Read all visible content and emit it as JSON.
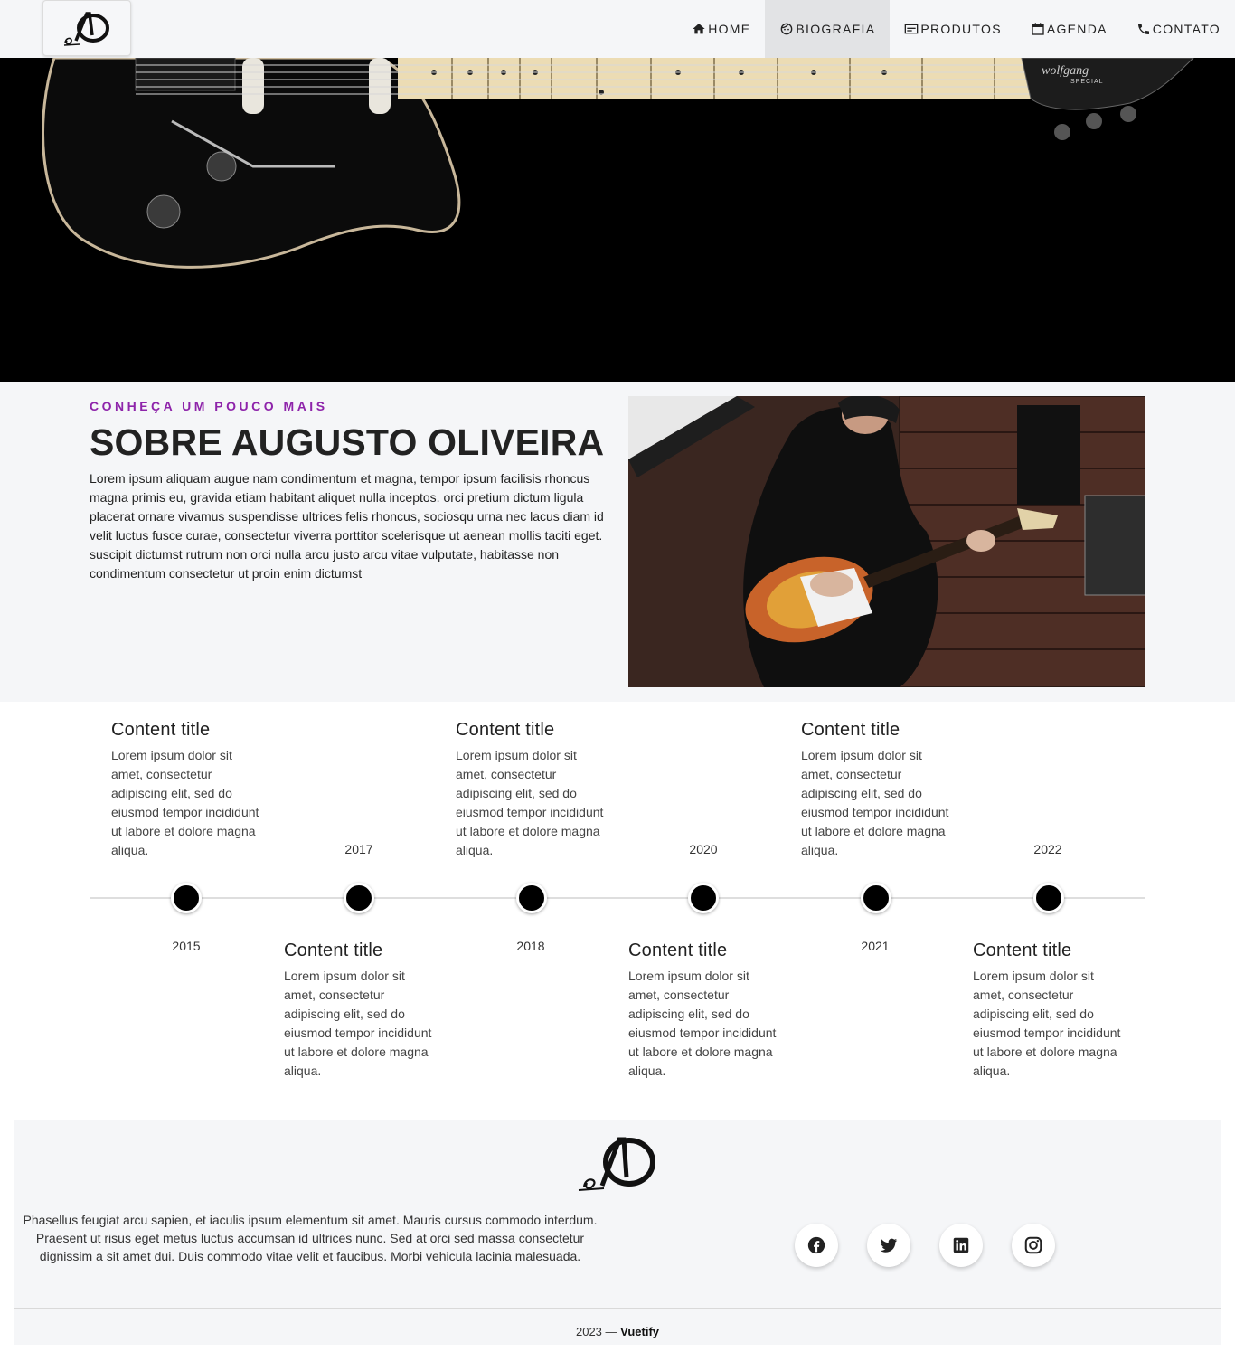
{
  "nav": {
    "items": [
      {
        "label": "HOME",
        "icon": "home-icon"
      },
      {
        "label": "BIOGRAFIA",
        "icon": "face-icon"
      },
      {
        "label": "PRODUTOS",
        "icon": "card-icon"
      },
      {
        "label": "AGENDA",
        "icon": "calendar-icon"
      },
      {
        "label": "CONTATO",
        "icon": "phone-icon"
      }
    ],
    "active": "BIOGRAFIA"
  },
  "hero": {
    "guitar_brand": "wolfgang",
    "guitar_model": "SPECIAL"
  },
  "about": {
    "eyebrow": "CONHEÇA UM POUCO MAIS",
    "title": "SOBRE AUGUSTO OLIVEIRA",
    "text": "Lorem ipsum aliquam augue nam condimentum et magna, tempor ipsum facilisis rhoncus magna primis eu, gravida etiam habitant aliquet nulla inceptos. orci pretium dictum ligula placerat ornare vivamus suspendisse ultrices felis rhoncus, sociosqu urna nec lacus diam id velit luctus fusce curae, consectetur viverra porttitor scelerisque ut aenean mollis taciti eget. suscipit dictumst rutrum non orci nulla arcu justo arcu vitae vulputate, habitasse non condimentum consectetur ut proin enim dictumst"
  },
  "timeline": {
    "events": [
      {
        "year": "2015",
        "title": "Content title",
        "text": "Lorem ipsum dolor sit amet, consectetur adipiscing elit, sed do eiusmod tempor incididunt ut labore et dolore magna aliqua."
      },
      {
        "year": "2017",
        "title": "Content title",
        "text": "Lorem ipsum dolor sit amet, consectetur adipiscing elit, sed do eiusmod tempor incididunt ut labore et dolore magna aliqua."
      },
      {
        "year": "2018",
        "title": "Content title",
        "text": "Lorem ipsum dolor sit amet, consectetur adipiscing elit, sed do eiusmod tempor incididunt ut labore et dolore magna aliqua."
      },
      {
        "year": "2020",
        "title": "Content title",
        "text": "Lorem ipsum dolor sit amet, consectetur adipiscing elit, sed do eiusmod tempor incididunt ut labore et dolore magna aliqua."
      },
      {
        "year": "2021",
        "title": "Content title",
        "text": "Lorem ipsum dolor sit amet, consectetur adipiscing elit, sed do eiusmod tempor incididunt ut labore et dolore magna aliqua."
      },
      {
        "year": "2022",
        "title": "Content title",
        "text": "Lorem ipsum dolor sit amet, consectetur adipiscing elit, sed do eiusmod tempor incididunt ut labore et dolore magna aliqua."
      }
    ]
  },
  "footer": {
    "text": "Phasellus feugiat arcu sapien, et iaculis ipsum elementum sit amet. Mauris cursus commodo interdum. Praesent ut risus eget metus luctus accumsan id ultrices nunc. Sed at orci sed massa consectetur dignissim a sit amet dui. Duis commodo vitae velit et faucibus. Morbi vehicula lacinia malesuada.",
    "social": [
      "facebook-icon",
      "twitter-icon",
      "linkedin-icon",
      "instagram-icon"
    ],
    "year": "2023",
    "separator": "—",
    "brand": "Vuetify"
  },
  "colors": {
    "accent": "#8e24aa",
    "bar": "#f5f6f8",
    "active_tab": "#e2e3e5"
  }
}
